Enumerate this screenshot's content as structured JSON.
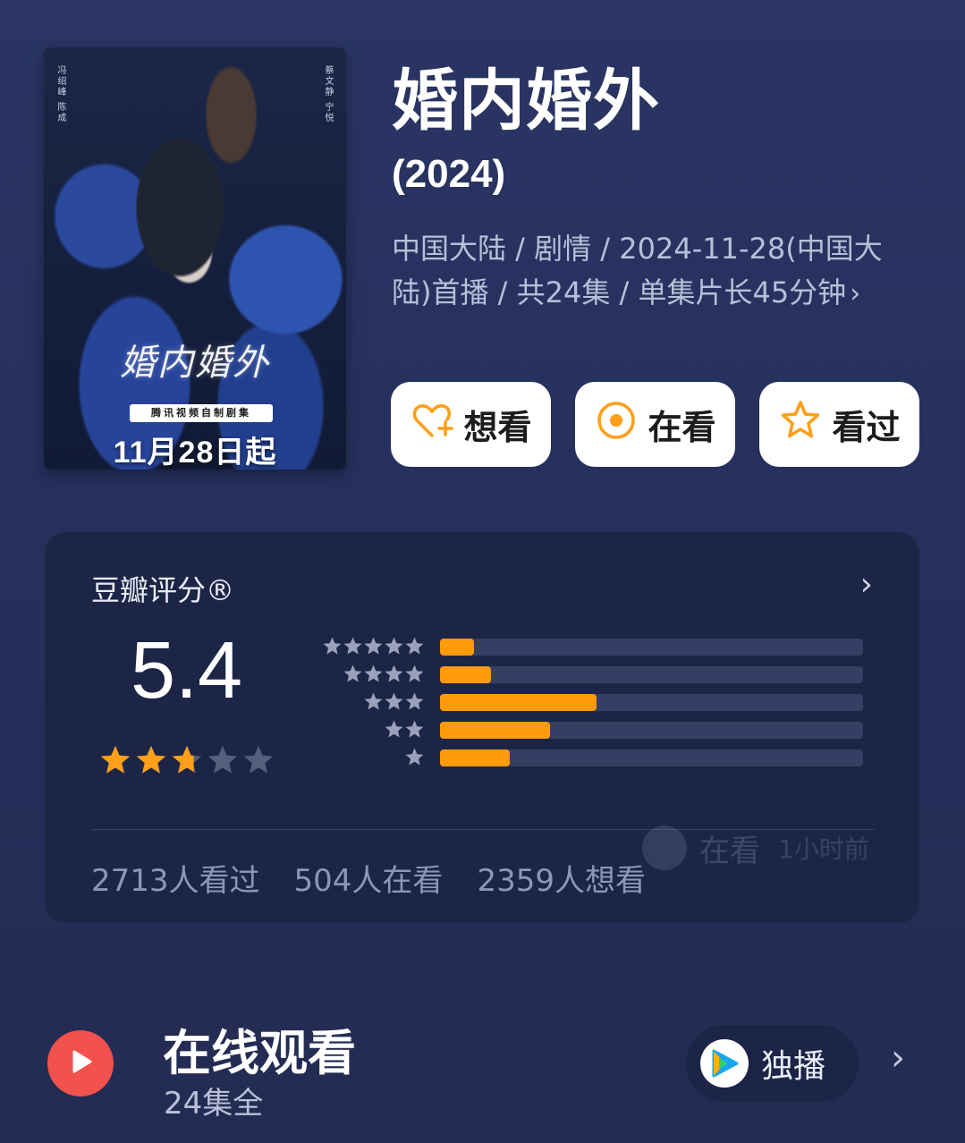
{
  "poster": {
    "cast_left": "冯绍峰 陈成",
    "cast_right": "蔡文静 宁悦",
    "art_title": "婚内婚外",
    "tag": "腾讯视频自制剧集",
    "date": "11月28日起"
  },
  "header": {
    "title": "婚内婚外",
    "year": "(2024)",
    "meta": "中国大陆 / 剧情 / 2024-11-28(中国大陆)首播 / 共24集 / 单集片长45分钟",
    "meta_chevron": "›"
  },
  "actions": [
    {
      "label": "想看",
      "icon": "heart-plus-icon"
    },
    {
      "label": "在看",
      "icon": "target-circle-icon"
    },
    {
      "label": "看过",
      "icon": "star-outline-icon"
    }
  ],
  "rating": {
    "label": "豆瓣评分®",
    "chevron": "›",
    "score": "5.4",
    "stars_value": 2.7,
    "stars_max": 5,
    "distribution": [
      {
        "stars": 5,
        "fraction": 0.08
      },
      {
        "stars": 4,
        "fraction": 0.12
      },
      {
        "stars": 3,
        "fraction": 0.37
      },
      {
        "stars": 2,
        "fraction": 0.26
      },
      {
        "stars": 1,
        "fraction": 0.165
      }
    ],
    "ghost_status": "在看",
    "ghost_time": "1小时前",
    "stats": {
      "watched": "2713人看过",
      "watching": "504人在看",
      "want": "2359人想看"
    }
  },
  "online": {
    "title": "在线观看",
    "subtitle": "24集全",
    "exclusive_label": "独播",
    "chevron": "›"
  },
  "colors": {
    "accent_orange": "#ff9a0b",
    "play_red": "#f2514e",
    "card_bg": "#1d2546",
    "page_bg": "#27315d"
  }
}
